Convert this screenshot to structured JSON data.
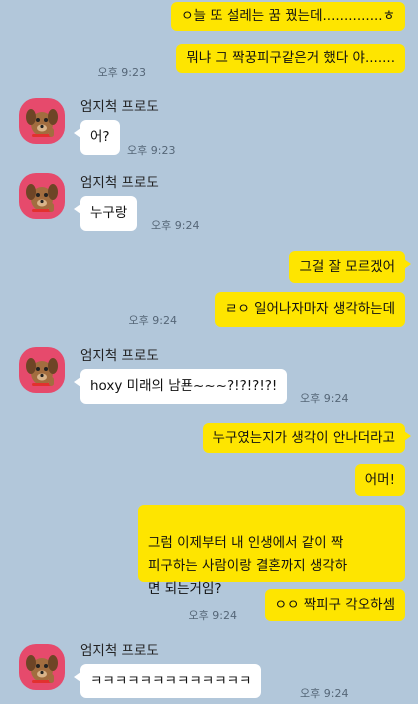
{
  "contact": {
    "name": "엄지척 프로도"
  },
  "messages": [
    {
      "side": "me",
      "text": "ㅇ늘 또 설레는 꿈 꿨는데..............ㅎ",
      "time": ""
    },
    {
      "side": "me",
      "text": "뭐냐 그 짝꿍피구같은거 했다 야.......",
      "time": "오후 9:23"
    },
    {
      "side": "them",
      "text": "어?",
      "time": "오후 9:23"
    },
    {
      "side": "them",
      "text": "누구랑",
      "time": "오후 9:24"
    },
    {
      "side": "me",
      "text": "그걸 잘 모르겠어",
      "time": ""
    },
    {
      "side": "me",
      "text": "ㄹㅇ 일어나자마자 생각하는데",
      "time": "오후 9:24"
    },
    {
      "side": "them",
      "text": "hoxy 미래의 남푠~~~?!?!?!?!",
      "time": "오후 9:24"
    },
    {
      "side": "me",
      "text": "누구였는지가 생각이 안나더라고",
      "time": ""
    },
    {
      "side": "me",
      "text": "어머!",
      "time": ""
    },
    {
      "side": "me",
      "text": "그럼 이제부터 내 인생에서 같이 짝\n피구하는 사람이랑 결혼까지 생각하\n면 되는거임?",
      "time": ""
    },
    {
      "side": "me",
      "text": "ㅇㅇ 짝피구 각오하셈",
      "time": "오후 9:24"
    },
    {
      "side": "them",
      "text": "ㅋㅋㅋㅋㅋㅋㅋㅋㅋㅋㅋㅋㅋ",
      "time": "오후 9:24"
    }
  ],
  "avatar_icon": "dog-character-icon",
  "colors": {
    "background": "#b2c7da",
    "my_bubble": "#fee500",
    "their_bubble": "#ffffff",
    "avatar_bg": "#e64a6c"
  }
}
